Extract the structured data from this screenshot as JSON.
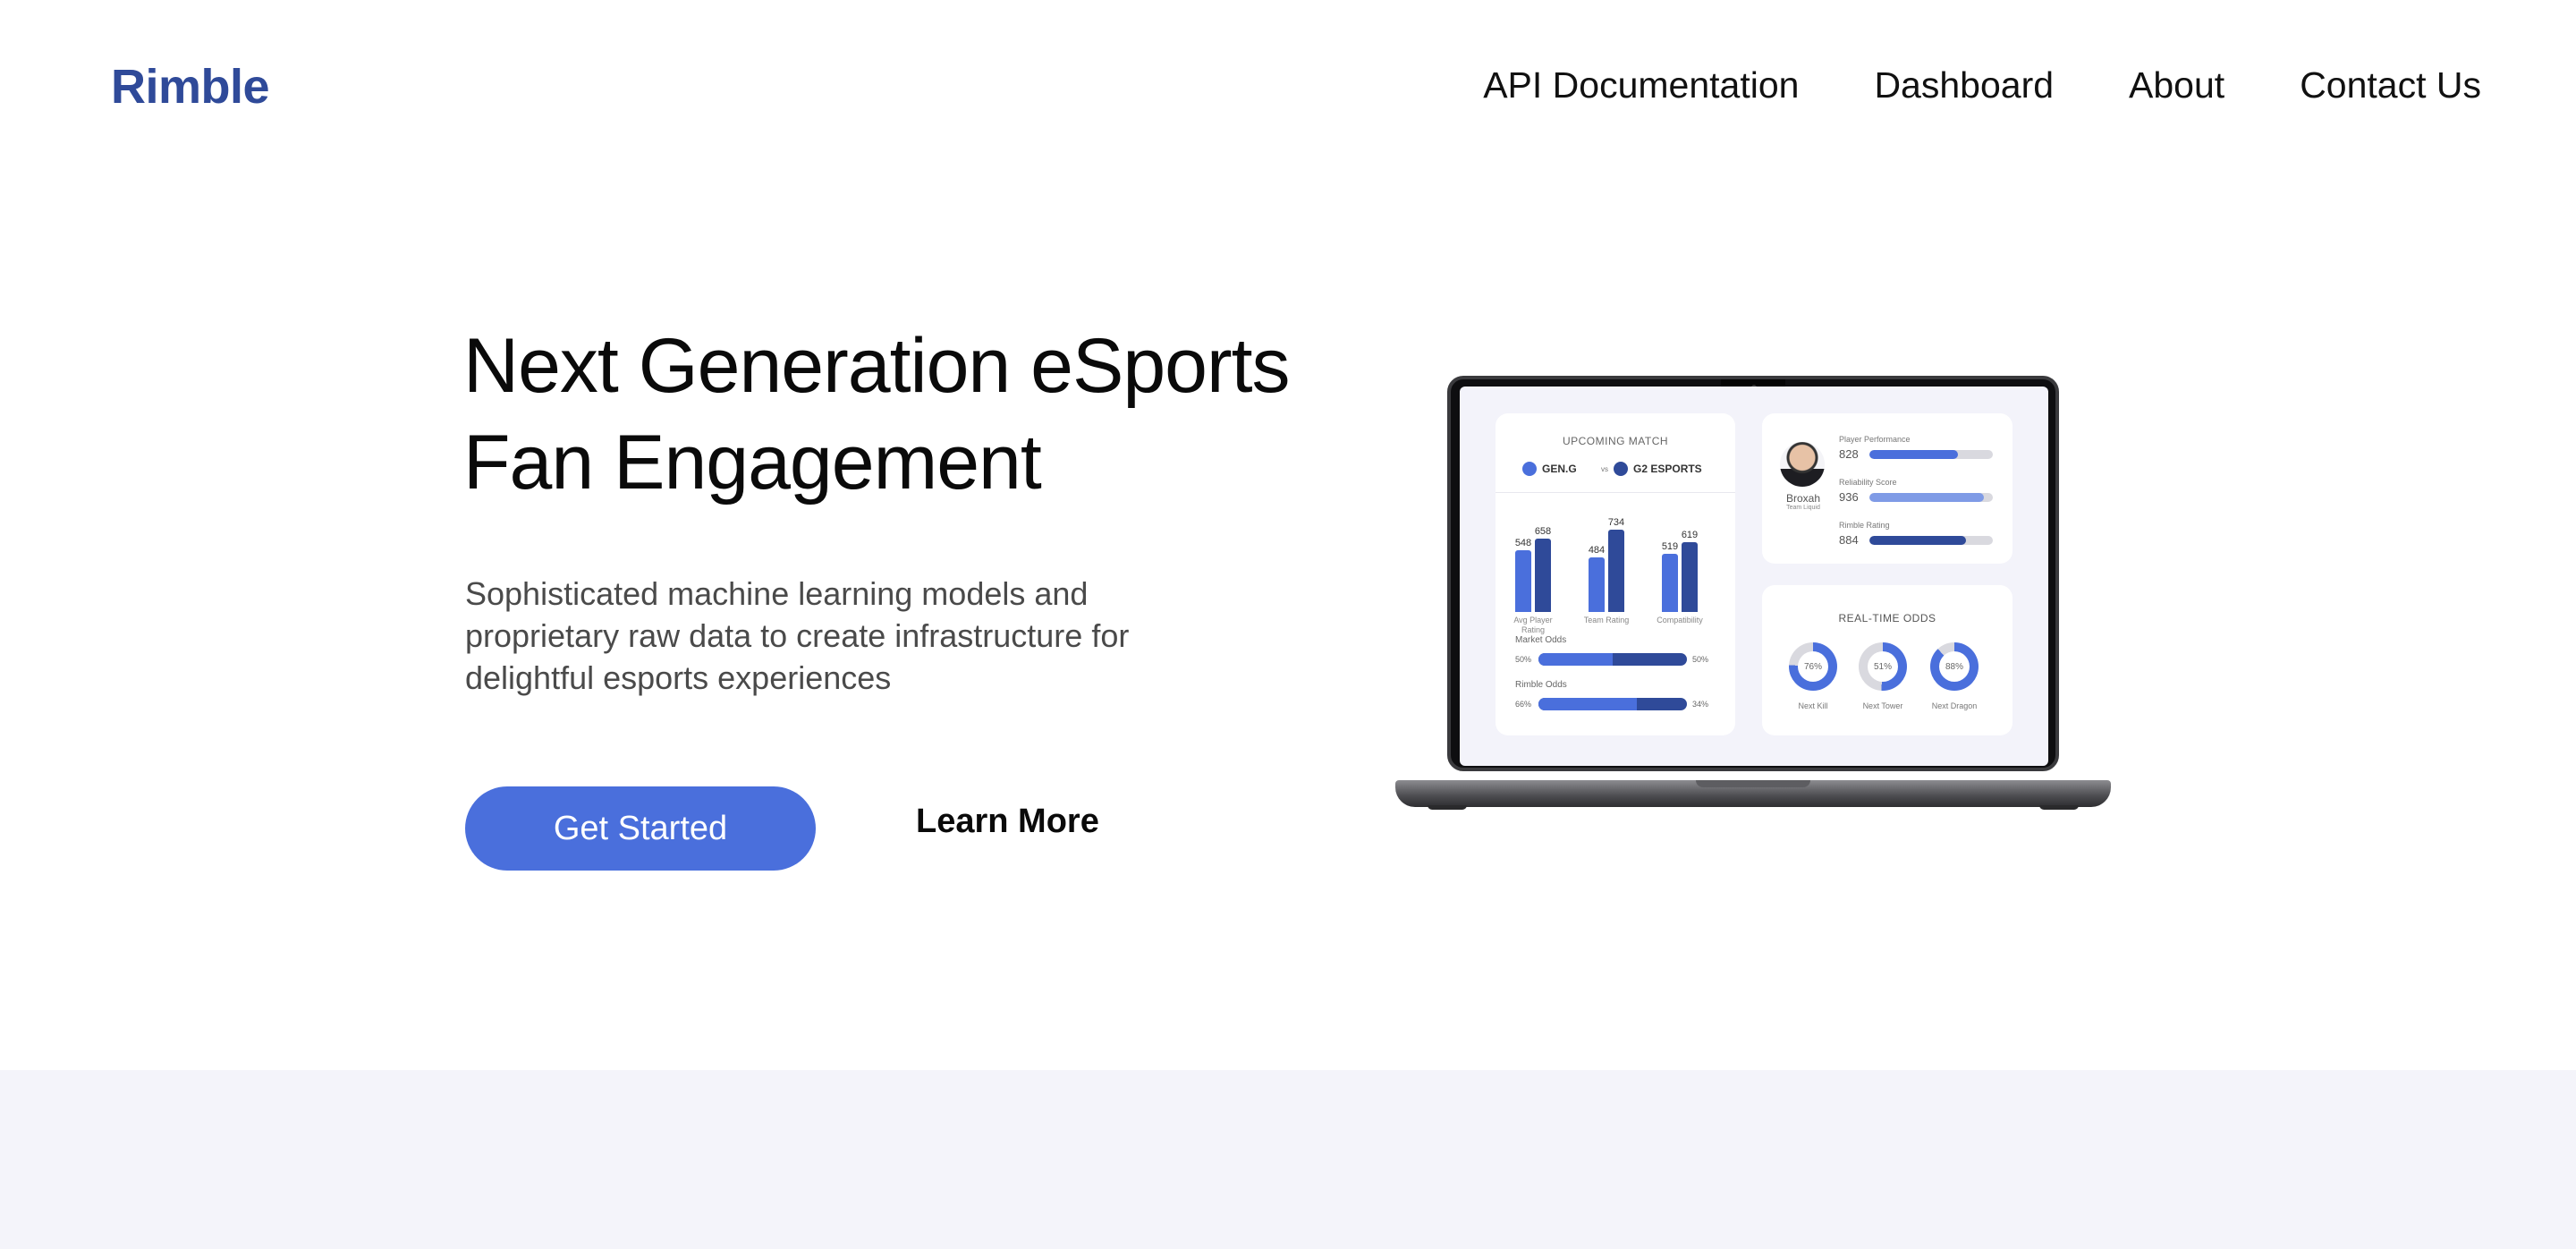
{
  "header": {
    "brand": "Rimble",
    "nav": [
      "API Documentation",
      "Dashboard",
      "About",
      "Contact Us"
    ]
  },
  "hero": {
    "title_line1": "Next Generation eSports",
    "title_line2": "Fan Engagement",
    "subtitle": "Sophisticated machine learning models and proprietary raw data to create infrastructure for delightful esports experiences",
    "primary_button": "Get Started",
    "secondary_link": "Learn More"
  },
  "colors": {
    "brand": "#2f4a99",
    "accent": "#4a6fdc",
    "dark_series": "#2f4a99",
    "light_series": "#4a6fdc",
    "band": "#f4f4fa"
  },
  "laptop": {
    "match_card": {
      "title": "UPCOMING MATCH",
      "team_a": "GEN.G",
      "vs": "vs",
      "team_b": "G2 ESPORTS",
      "bars": [
        {
          "category": "Avg Player Rating",
          "a": 548,
          "b": 658
        },
        {
          "category": "Team Rating",
          "a": 484,
          "b": 734
        },
        {
          "category": "Compatibility",
          "a": 519,
          "b": 619
        }
      ],
      "market_odds_label": "Market Odds",
      "market_odds": {
        "left": "50%",
        "right": "50%",
        "fill": 0.5
      },
      "rimble_odds_label": "Rimble Odds",
      "rimble_odds": {
        "left": "66%",
        "right": "34%",
        "fill": 0.66
      }
    },
    "player_card": {
      "name": "Broxah",
      "team": "Team Liquid",
      "stats": [
        {
          "label": "Player Performance",
          "value": "828",
          "fill": 0.72,
          "color": "#4a6fdc"
        },
        {
          "label": "Reliability Score",
          "value": "936",
          "fill": 0.93,
          "color": "#7f9be6"
        },
        {
          "label": "Rimble Rating",
          "value": "884",
          "fill": 0.78,
          "color": "#2f4a99"
        }
      ]
    },
    "odds_card": {
      "title": "REAL-TIME ODDS",
      "donuts": [
        {
          "label": "Next Kill",
          "value": "76%",
          "fill": 0.76
        },
        {
          "label": "Next Tower",
          "value": "51%",
          "fill": 0.51
        },
        {
          "label": "Next Dragon",
          "value": "88%",
          "fill": 0.88
        }
      ]
    }
  }
}
